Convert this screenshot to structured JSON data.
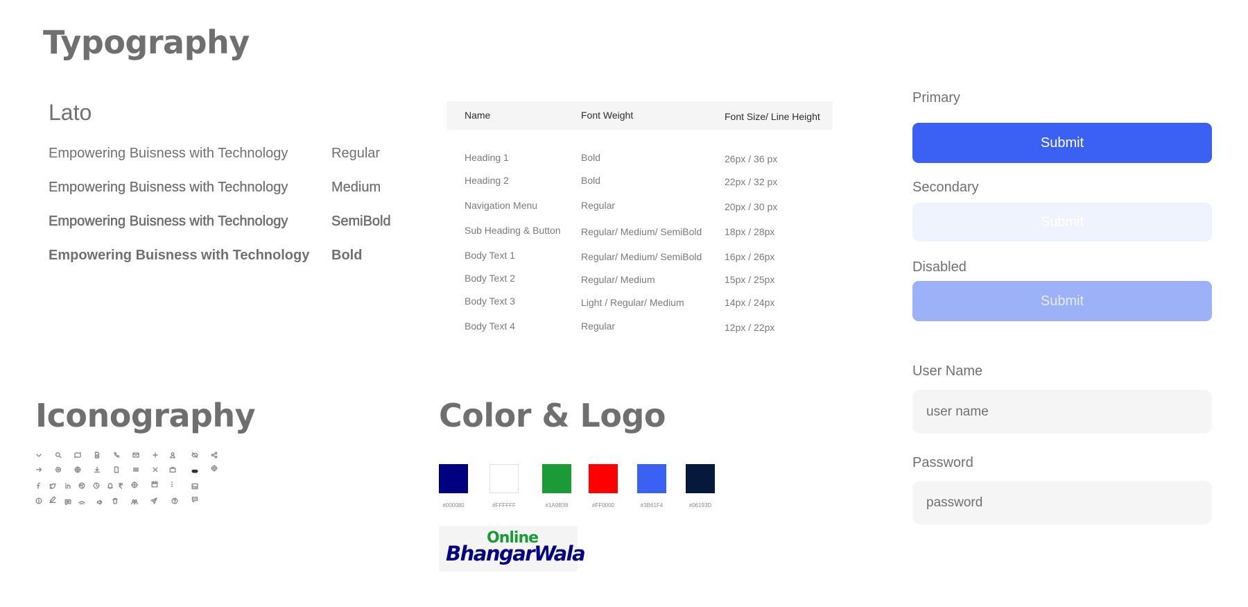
{
  "typography": {
    "title": "Typography",
    "font_name": "Lato",
    "samples": [
      {
        "text": "Empowering Buisness with Technology",
        "weight": "Regular"
      },
      {
        "text": "Empowering Buisness with Technology",
        "weight": "Medium"
      },
      {
        "text": "Empowering Buisness with Technology",
        "weight": "SemiBold"
      },
      {
        "text": "Empowering Buisness with Technology",
        "weight": "Bold"
      }
    ],
    "table": {
      "headers": [
        "Name",
        "Font Weight",
        "Font Size/ Line Height"
      ],
      "rows": [
        [
          "Heading 1",
          "Bold",
          "26px / 36 px"
        ],
        [
          "Heading 2",
          "Bold",
          "22px / 32 px"
        ],
        [
          "Navigation Menu",
          "Regular",
          "20px / 30 px"
        ],
        [
          "Sub Heading & Button",
          "Regular/ Medium/ SemiBold",
          "18px / 28px"
        ],
        [
          "Body Text 1",
          "Regular/ Medium/ SemiBold",
          "16px / 26px"
        ],
        [
          "Body Text 2",
          "Regular/ Medium",
          "15px / 25px"
        ],
        [
          "Body Text 3",
          "Light / Regular/ Medium",
          "14px / 24px"
        ],
        [
          "Body Text 4",
          "Regular",
          "12px / 22px"
        ]
      ]
    }
  },
  "buttons": {
    "primary_label": "Primary",
    "secondary_label": "Secondary",
    "disabled_label": "Disabled",
    "submit": "Submit"
  },
  "form": {
    "username_label": "User Name",
    "username_placeholder": "user name",
    "password_label": "Password",
    "password_placeholder": "password"
  },
  "iconography": {
    "title": "Iconography",
    "icons": [
      "chevron-down-icon",
      "search-icon",
      "map-icon",
      "document-icon",
      "phone-icon",
      "mail-icon",
      "plus-icon",
      "user-icon",
      "eye-off-icon",
      "share-icon",
      "arrow-right-icon",
      "settings-icon",
      "globe-icon",
      "download-icon",
      "file-icon",
      "menu-icon",
      "close-icon",
      "briefcase-icon",
      "toggle-icon",
      "gear-icon",
      "facebook-icon",
      "twitter-icon",
      "linkedin-icon",
      "dribbble-icon",
      "clock-icon",
      "bell-icon",
      "rupee-icon",
      "target-icon",
      "calendar-icon",
      "more-vertical-icon",
      "image-icon",
      "info-icon",
      "edit-icon",
      "chat-icon",
      "wifi-icon",
      "volume-icon",
      "trash-icon",
      "users-icon",
      "send-icon",
      "help-icon",
      "message-icon"
    ]
  },
  "color_logo": {
    "title": "Color & Logo",
    "swatches": [
      {
        "hex": "#000080",
        "label": "#000080"
      },
      {
        "hex": "#FFFFFF",
        "label": "#FFFFFF"
      },
      {
        "hex": "#1A9B38",
        "label": "#1A9B38"
      },
      {
        "hex": "#FF0000",
        "label": "#FF0000"
      },
      {
        "hex": "#3B61F4",
        "label": "#3B61F4"
      },
      {
        "hex": "#06193D",
        "label": "#06193D"
      }
    ],
    "logo": {
      "top": "Online",
      "main": "BhangarWala"
    }
  },
  "colors": {
    "primary": "#3b61f4",
    "text": "#707070"
  }
}
